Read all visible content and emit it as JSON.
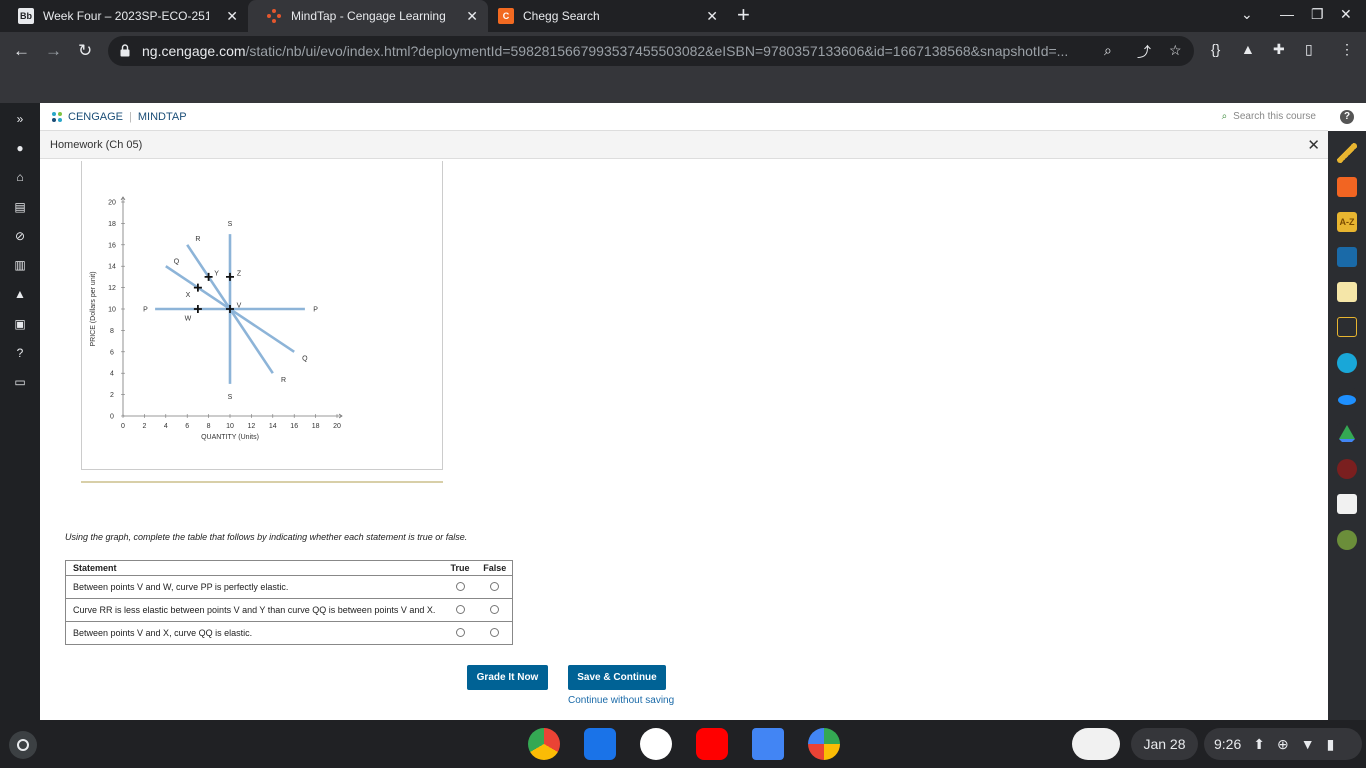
{
  "browser": {
    "tabs": [
      {
        "title": "Week Four – 2023SP-ECO-251-IC",
        "favicon": "Bb"
      },
      {
        "title": "MindTap - Cengage Learning",
        "favicon": "mindtap-icon"
      },
      {
        "title": "Chegg Search",
        "favicon": "C"
      }
    ],
    "url_host": "ng.cengage.com",
    "url_path": "/static/nb/ui/evo/index.html?deploymentId=5982815667993537455503082&eISBN=9780357133606&id=1667138568&snapshotId=..."
  },
  "app": {
    "brand": "CENGAGE",
    "product": "MINDTAP",
    "search_placeholder": "Search this course",
    "breadcrumb": "Homework (Ch 05)"
  },
  "chart_data": {
    "type": "line",
    "xlabel": "QUANTITY (Units)",
    "ylabel": "PRICE (Dollars per unit)",
    "xlim": [
      0,
      20
    ],
    "ylim": [
      0,
      20
    ],
    "xticks": [
      0,
      2,
      4,
      6,
      8,
      10,
      12,
      14,
      16,
      18,
      20
    ],
    "yticks": [
      0,
      2,
      4,
      6,
      8,
      10,
      12,
      14,
      16,
      18,
      20
    ],
    "series": [
      {
        "name": "S",
        "points": [
          [
            10,
            17
          ],
          [
            10,
            3
          ]
        ],
        "labels": [
          {
            "text": "S",
            "at": [
              10,
              18
            ]
          },
          {
            "text": "S",
            "at": [
              10,
              1.8
            ]
          }
        ]
      },
      {
        "name": "P",
        "points": [
          [
            3,
            10
          ],
          [
            17,
            10
          ]
        ],
        "labels": [
          {
            "text": "P",
            "at": [
              2.1,
              10
            ]
          },
          {
            "text": "P",
            "at": [
              18,
              10
            ]
          }
        ]
      },
      {
        "name": "Q",
        "points": [
          [
            4,
            14
          ],
          [
            16,
            6
          ]
        ],
        "labels": [
          {
            "text": "Q",
            "at": [
              5,
              14.5
            ]
          },
          {
            "text": "Q",
            "at": [
              17,
              5.4
            ]
          }
        ]
      },
      {
        "name": "R",
        "points": [
          [
            6,
            16
          ],
          [
            14,
            4
          ]
        ],
        "labels": [
          {
            "text": "R",
            "at": [
              7,
              16.6
            ]
          },
          {
            "text": "R",
            "at": [
              15,
              3.4
            ]
          }
        ]
      }
    ],
    "points": [
      {
        "label": "V",
        "x": 10,
        "y": 10
      },
      {
        "label": "W",
        "x": 7,
        "y": 10
      },
      {
        "label": "X",
        "x": 7,
        "y": 12
      },
      {
        "label": "Y",
        "x": 8,
        "y": 13
      },
      {
        "label": "Z",
        "x": 10,
        "y": 13
      }
    ],
    "line_color": "#8db4d8"
  },
  "question": {
    "instruction": "Using the graph, complete the table that follows by indicating whether each statement is true or false.",
    "headers": {
      "statement": "Statement",
      "true": "True",
      "false": "False"
    },
    "rows": [
      "Between points V and W, curve PP is perfectly elastic.",
      "Curve RR is less elastic between points V and Y than curve QQ is between points V and X.",
      "Between points V and X, curve QQ is elastic."
    ]
  },
  "actions": {
    "grade": "Grade It Now",
    "save": "Save & Continue",
    "continue": "Continue without saving"
  },
  "shelf": {
    "date": "Jan 28",
    "time": "9:26"
  },
  "colors": {
    "primary_button": "#006295",
    "browser_dark": "#202124"
  }
}
